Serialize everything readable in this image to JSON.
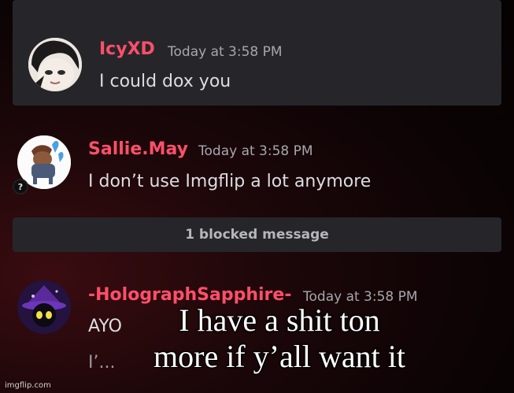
{
  "messages": [
    {
      "username": "IcyXD",
      "username_color": "#ff4f6a",
      "timestamp": "Today at 3:58 PM",
      "text": "I could dox you",
      "avatar_icon": "anime-character-avatar"
    },
    {
      "username": "Sallie.May",
      "username_color": "#ff4f6a",
      "timestamp": "Today at 3:58 PM",
      "text": "I don’t use Imgflip a lot anymore",
      "avatar_icon": "pony-character-avatar",
      "badge": "?"
    },
    {
      "username": "-HolographSapphire-",
      "username_color": "#ff4f6a",
      "timestamp": "Today at 3:58 PM",
      "text": "AYO",
      "text_line2": "I’...",
      "avatar_icon": "purple-witch-avatar"
    }
  ],
  "blocked": {
    "label": "1 blocked message"
  },
  "caption": {
    "line1": "I have a shit ton",
    "line2": "more if y’all want it"
  },
  "watermark": "imgflip.com"
}
